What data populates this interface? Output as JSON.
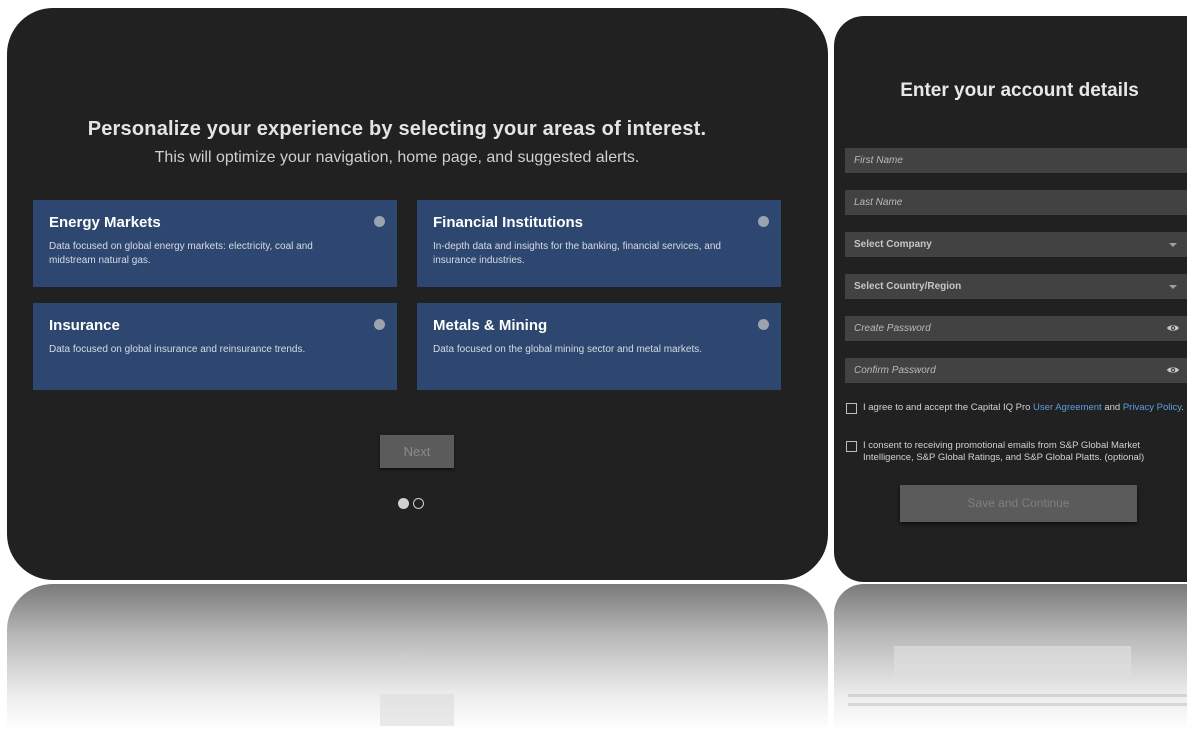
{
  "interests": {
    "headline": "Personalize your experience by selecting your areas of interest.",
    "subheadline": "This will optimize your navigation, home page, and suggested alerts.",
    "cards": [
      {
        "title": "Energy Markets",
        "description": "Data focused on global energy markets: electricity, coal and midstream natural gas."
      },
      {
        "title": "Financial Institutions",
        "description": "In-depth data and insights for the banking, financial services, and insurance industries."
      },
      {
        "title": "Insurance",
        "description": "Data focused on global insurance and reinsurance trends."
      },
      {
        "title": "Metals & Mining",
        "description": "Data focused on the global mining sector and metal markets."
      }
    ],
    "next_label": "Next"
  },
  "account": {
    "title": "Enter your account details",
    "fields": {
      "first_name": "First Name",
      "last_name": "Last Name",
      "company": "Select Company",
      "country": "Select Country/Region",
      "create_password": "Create Password",
      "confirm_password": "Confirm Password"
    },
    "agreement": {
      "prefix": "I agree to and accept the Capital IQ Pro ",
      "user_agreement_link": "User Agreement",
      "middle": " and ",
      "privacy_link": "Privacy Policy",
      "suffix": "."
    },
    "consent_text": "I consent to receiving promotional emails from S&P Global Market Intelligence, S&P Global Ratings, and S&P Global Platts. (optional)",
    "save_label": "Save and Continue"
  },
  "colors": {
    "panel_bg": "#212121",
    "card_bg": "#2e4770",
    "field_bg": "#424242",
    "link": "#5f9ee0",
    "button_bg": "#5b5b5b"
  }
}
